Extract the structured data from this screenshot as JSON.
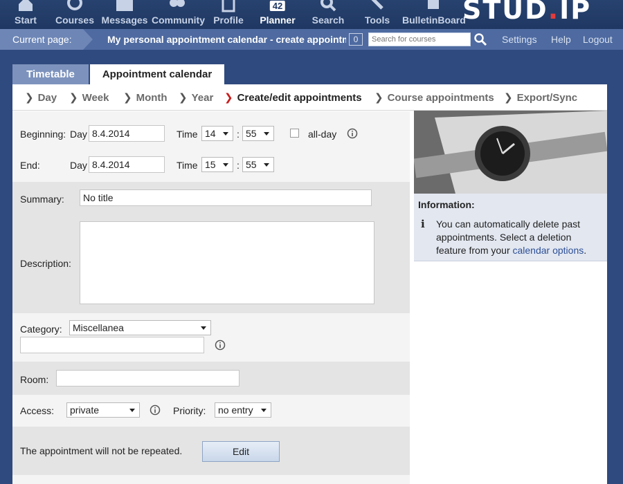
{
  "nav": {
    "items": [
      {
        "id": "start",
        "label": "Start"
      },
      {
        "id": "courses",
        "label": "Courses"
      },
      {
        "id": "messages",
        "label": "Messages"
      },
      {
        "id": "community",
        "label": "Community"
      },
      {
        "id": "profile",
        "label": "Profile"
      },
      {
        "id": "planner",
        "label": "Planner",
        "badge": "42",
        "active": true
      },
      {
        "id": "search",
        "label": "Search"
      },
      {
        "id": "tools",
        "label": "Tools"
      },
      {
        "id": "bulletinboard",
        "label": "BulletinBoard"
      }
    ],
    "logo_text": "STUD",
    "logo_dot": ".",
    "logo_suffix": "IP"
  },
  "subbar": {
    "current_label": "Current page:",
    "current_title": "My personal appointment calendar - create appointment",
    "course_count": "0",
    "search_placeholder": "Search for courses",
    "links": [
      "Settings",
      "Help",
      "Logout"
    ]
  },
  "tabs": [
    "Timetable",
    "Appointment calendar"
  ],
  "subnav": [
    {
      "label": "Day"
    },
    {
      "label": "Week"
    },
    {
      "label": "Month"
    },
    {
      "label": "Year"
    },
    {
      "label": "Create/edit appointments",
      "active": true
    },
    {
      "label": "Course appointments"
    },
    {
      "label": "Export/Sync"
    }
  ],
  "form": {
    "beginning_label": "Beginning:",
    "end_label": "End:",
    "day_label": "Day",
    "time_label": "Time",
    "beginning_date": "8.4.2014",
    "beginning_hour": "14",
    "beginning_minute": "55",
    "end_date": "8.4.2014",
    "end_hour": "15",
    "end_minute": "55",
    "colon": ":",
    "allday_label": "all-day",
    "summary_label": "Summary:",
    "summary_value": "No title",
    "description_label": "Description:",
    "category_label": "Category:",
    "category_value": "Miscellanea",
    "room_label": "Room:",
    "access_label": "Access:",
    "access_value": "private",
    "priority_label": "Priority:",
    "priority_value": "no entry",
    "repeat_text": "The appointment will not be repeated.",
    "edit_button": "Edit"
  },
  "info": {
    "title": "Information:",
    "text_before_link": "You can automatically delete past appointments. Select a deletion feature from your ",
    "link_text": "calendar options",
    "text_after_link": "."
  },
  "colors": {
    "nav_bg": "#1f3863",
    "subbar_bg": "#4e6aa0",
    "accent_red": "#c81c1c",
    "link": "#2d4f96"
  }
}
